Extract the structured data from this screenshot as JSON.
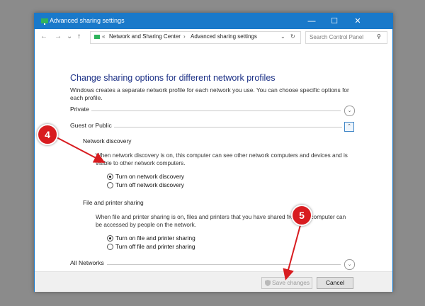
{
  "window": {
    "title": "Advanced sharing settings",
    "minimize_glyph": "—",
    "maximize_glyph": "☐",
    "close_glyph": "✕"
  },
  "nav": {
    "back_glyph": "←",
    "forward_glyph": "→",
    "dropdown_glyph": "⌄",
    "up_glyph": "↑",
    "breadcrumb_sep": "«",
    "breadcrumb": [
      "Network and Sharing Center",
      "Advanced sharing settings"
    ],
    "chevron_sep": "›",
    "refresh_glyph": "↻",
    "search_placeholder": "Search Control Panel",
    "search_glyph": "⚲"
  },
  "page": {
    "heading": "Change sharing options for different network profiles",
    "description": "Windows creates a separate network profile for each network you use. You can choose specific options for each profile."
  },
  "sections": {
    "private": {
      "label": "Private",
      "state": "collapsed"
    },
    "guest": {
      "label": "Guest or Public",
      "state": "expanded"
    },
    "all": {
      "label": "All Networks",
      "state": "collapsed"
    }
  },
  "network_discovery": {
    "title": "Network discovery",
    "text": "When network discovery is on, this computer can see other network computers and devices and is visible to other network computers.",
    "options": [
      {
        "label": "Turn on network discovery",
        "selected": true
      },
      {
        "label": "Turn off network discovery",
        "selected": false
      }
    ]
  },
  "file_sharing": {
    "title": "File and printer sharing",
    "text": "When file and printer sharing is on, files and printers that you have shared from this computer can be accessed by people on the network.",
    "options": [
      {
        "label": "Turn on file and printer sharing",
        "selected": true
      },
      {
        "label": "Turn off file and printer sharing",
        "selected": false
      }
    ]
  },
  "footer": {
    "save_label": "Save changes",
    "cancel_label": "Cancel"
  },
  "callouts": {
    "step4": "4",
    "step5": "5"
  },
  "colors": {
    "accent": "#1979ca",
    "heading": "#1e3287",
    "callout": "#d81c20"
  },
  "icons": {
    "window_icon": "network-sharing-icon",
    "shield": "shield-icon"
  },
  "chevron": {
    "down": "⌄",
    "up": "⌃"
  }
}
